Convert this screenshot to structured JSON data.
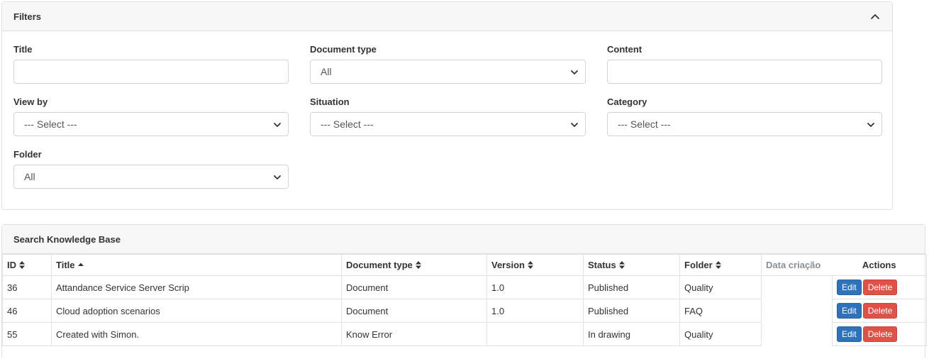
{
  "filters": {
    "title": "Filters",
    "fields": {
      "title": {
        "label": "Title",
        "value": "",
        "placeholder": ""
      },
      "document_type": {
        "label": "Document type",
        "selected": "All"
      },
      "content": {
        "label": "Content",
        "value": "",
        "placeholder": ""
      },
      "view_by": {
        "label": "View by",
        "selected": "--- Select ---"
      },
      "situation": {
        "label": "Situation",
        "selected": "--- Select ---"
      },
      "category": {
        "label": "Category",
        "selected": "--- Select ---"
      },
      "folder": {
        "label": "Folder",
        "selected": "All"
      }
    }
  },
  "kb": {
    "title": "Search Knowledge Base",
    "columns": {
      "id": "ID",
      "title": "Title",
      "document_type": "Document type",
      "version": "Version",
      "status": "Status",
      "folder": "Folder",
      "date": "Data criação",
      "actions": "Actions"
    },
    "sort": {
      "active_column": "Title",
      "direction": "ascending"
    },
    "rows": [
      {
        "id": "36",
        "title": "Attandance Service Server Scrip",
        "document_type": "Document",
        "version": "1.0",
        "status": "Published",
        "folder": "Quality",
        "date": "",
        "edit": "Edit",
        "delete": "Delete"
      },
      {
        "id": "46",
        "title": "Cloud adoption scenarios",
        "document_type": "Document",
        "version": "1.0",
        "status": "Published",
        "folder": "FAQ",
        "date": "",
        "edit": "Edit",
        "delete": "Delete"
      },
      {
        "id": "55",
        "title": "Created with Simon.",
        "document_type": "Know Error",
        "version": "",
        "status": "In drawing",
        "folder": "Quality",
        "date": "",
        "edit": "Edit",
        "delete": "Delete"
      }
    ]
  },
  "colors": {
    "edit_button": "#2f72ba",
    "delete_button": "#dd5347",
    "header_bg": "#f7f7f7",
    "border": "#dee2e6"
  }
}
